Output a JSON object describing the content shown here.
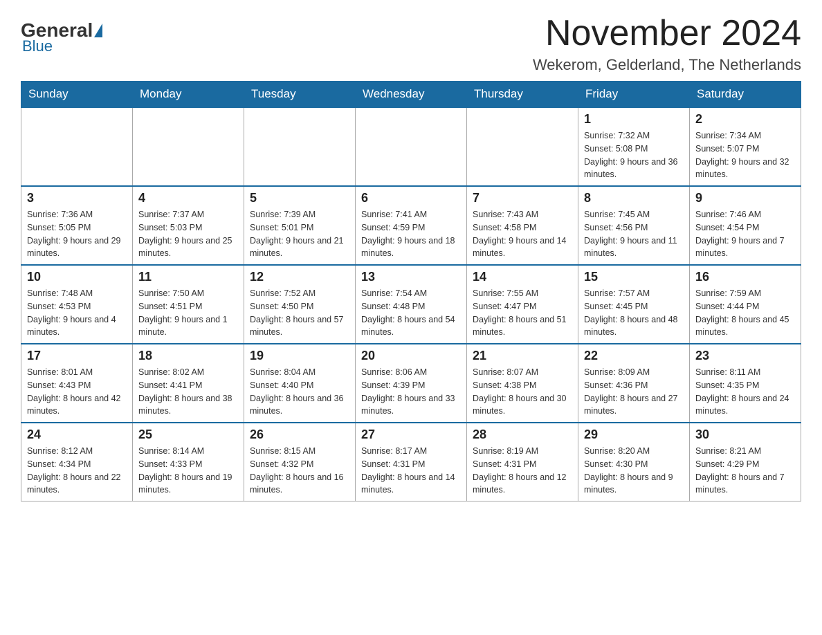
{
  "logo": {
    "general": "General",
    "blue": "Blue"
  },
  "header": {
    "month": "November 2024",
    "location": "Wekerom, Gelderland, The Netherlands"
  },
  "weekdays": [
    "Sunday",
    "Monday",
    "Tuesday",
    "Wednesday",
    "Thursday",
    "Friday",
    "Saturday"
  ],
  "weeks": [
    [
      {
        "day": "",
        "sunrise": "",
        "sunset": "",
        "daylight": ""
      },
      {
        "day": "",
        "sunrise": "",
        "sunset": "",
        "daylight": ""
      },
      {
        "day": "",
        "sunrise": "",
        "sunset": "",
        "daylight": ""
      },
      {
        "day": "",
        "sunrise": "",
        "sunset": "",
        "daylight": ""
      },
      {
        "day": "",
        "sunrise": "",
        "sunset": "",
        "daylight": ""
      },
      {
        "day": "1",
        "sunrise": "Sunrise: 7:32 AM",
        "sunset": "Sunset: 5:08 PM",
        "daylight": "Daylight: 9 hours and 36 minutes."
      },
      {
        "day": "2",
        "sunrise": "Sunrise: 7:34 AM",
        "sunset": "Sunset: 5:07 PM",
        "daylight": "Daylight: 9 hours and 32 minutes."
      }
    ],
    [
      {
        "day": "3",
        "sunrise": "Sunrise: 7:36 AM",
        "sunset": "Sunset: 5:05 PM",
        "daylight": "Daylight: 9 hours and 29 minutes."
      },
      {
        "day": "4",
        "sunrise": "Sunrise: 7:37 AM",
        "sunset": "Sunset: 5:03 PM",
        "daylight": "Daylight: 9 hours and 25 minutes."
      },
      {
        "day": "5",
        "sunrise": "Sunrise: 7:39 AM",
        "sunset": "Sunset: 5:01 PM",
        "daylight": "Daylight: 9 hours and 21 minutes."
      },
      {
        "day": "6",
        "sunrise": "Sunrise: 7:41 AM",
        "sunset": "Sunset: 4:59 PM",
        "daylight": "Daylight: 9 hours and 18 minutes."
      },
      {
        "day": "7",
        "sunrise": "Sunrise: 7:43 AM",
        "sunset": "Sunset: 4:58 PM",
        "daylight": "Daylight: 9 hours and 14 minutes."
      },
      {
        "day": "8",
        "sunrise": "Sunrise: 7:45 AM",
        "sunset": "Sunset: 4:56 PM",
        "daylight": "Daylight: 9 hours and 11 minutes."
      },
      {
        "day": "9",
        "sunrise": "Sunrise: 7:46 AM",
        "sunset": "Sunset: 4:54 PM",
        "daylight": "Daylight: 9 hours and 7 minutes."
      }
    ],
    [
      {
        "day": "10",
        "sunrise": "Sunrise: 7:48 AM",
        "sunset": "Sunset: 4:53 PM",
        "daylight": "Daylight: 9 hours and 4 minutes."
      },
      {
        "day": "11",
        "sunrise": "Sunrise: 7:50 AM",
        "sunset": "Sunset: 4:51 PM",
        "daylight": "Daylight: 9 hours and 1 minute."
      },
      {
        "day": "12",
        "sunrise": "Sunrise: 7:52 AM",
        "sunset": "Sunset: 4:50 PM",
        "daylight": "Daylight: 8 hours and 57 minutes."
      },
      {
        "day": "13",
        "sunrise": "Sunrise: 7:54 AM",
        "sunset": "Sunset: 4:48 PM",
        "daylight": "Daylight: 8 hours and 54 minutes."
      },
      {
        "day": "14",
        "sunrise": "Sunrise: 7:55 AM",
        "sunset": "Sunset: 4:47 PM",
        "daylight": "Daylight: 8 hours and 51 minutes."
      },
      {
        "day": "15",
        "sunrise": "Sunrise: 7:57 AM",
        "sunset": "Sunset: 4:45 PM",
        "daylight": "Daylight: 8 hours and 48 minutes."
      },
      {
        "day": "16",
        "sunrise": "Sunrise: 7:59 AM",
        "sunset": "Sunset: 4:44 PM",
        "daylight": "Daylight: 8 hours and 45 minutes."
      }
    ],
    [
      {
        "day": "17",
        "sunrise": "Sunrise: 8:01 AM",
        "sunset": "Sunset: 4:43 PM",
        "daylight": "Daylight: 8 hours and 42 minutes."
      },
      {
        "day": "18",
        "sunrise": "Sunrise: 8:02 AM",
        "sunset": "Sunset: 4:41 PM",
        "daylight": "Daylight: 8 hours and 38 minutes."
      },
      {
        "day": "19",
        "sunrise": "Sunrise: 8:04 AM",
        "sunset": "Sunset: 4:40 PM",
        "daylight": "Daylight: 8 hours and 36 minutes."
      },
      {
        "day": "20",
        "sunrise": "Sunrise: 8:06 AM",
        "sunset": "Sunset: 4:39 PM",
        "daylight": "Daylight: 8 hours and 33 minutes."
      },
      {
        "day": "21",
        "sunrise": "Sunrise: 8:07 AM",
        "sunset": "Sunset: 4:38 PM",
        "daylight": "Daylight: 8 hours and 30 minutes."
      },
      {
        "day": "22",
        "sunrise": "Sunrise: 8:09 AM",
        "sunset": "Sunset: 4:36 PM",
        "daylight": "Daylight: 8 hours and 27 minutes."
      },
      {
        "day": "23",
        "sunrise": "Sunrise: 8:11 AM",
        "sunset": "Sunset: 4:35 PM",
        "daylight": "Daylight: 8 hours and 24 minutes."
      }
    ],
    [
      {
        "day": "24",
        "sunrise": "Sunrise: 8:12 AM",
        "sunset": "Sunset: 4:34 PM",
        "daylight": "Daylight: 8 hours and 22 minutes."
      },
      {
        "day": "25",
        "sunrise": "Sunrise: 8:14 AM",
        "sunset": "Sunset: 4:33 PM",
        "daylight": "Daylight: 8 hours and 19 minutes."
      },
      {
        "day": "26",
        "sunrise": "Sunrise: 8:15 AM",
        "sunset": "Sunset: 4:32 PM",
        "daylight": "Daylight: 8 hours and 16 minutes."
      },
      {
        "day": "27",
        "sunrise": "Sunrise: 8:17 AM",
        "sunset": "Sunset: 4:31 PM",
        "daylight": "Daylight: 8 hours and 14 minutes."
      },
      {
        "day": "28",
        "sunrise": "Sunrise: 8:19 AM",
        "sunset": "Sunset: 4:31 PM",
        "daylight": "Daylight: 8 hours and 12 minutes."
      },
      {
        "day": "29",
        "sunrise": "Sunrise: 8:20 AM",
        "sunset": "Sunset: 4:30 PM",
        "daylight": "Daylight: 8 hours and 9 minutes."
      },
      {
        "day": "30",
        "sunrise": "Sunrise: 8:21 AM",
        "sunset": "Sunset: 4:29 PM",
        "daylight": "Daylight: 8 hours and 7 minutes."
      }
    ]
  ]
}
